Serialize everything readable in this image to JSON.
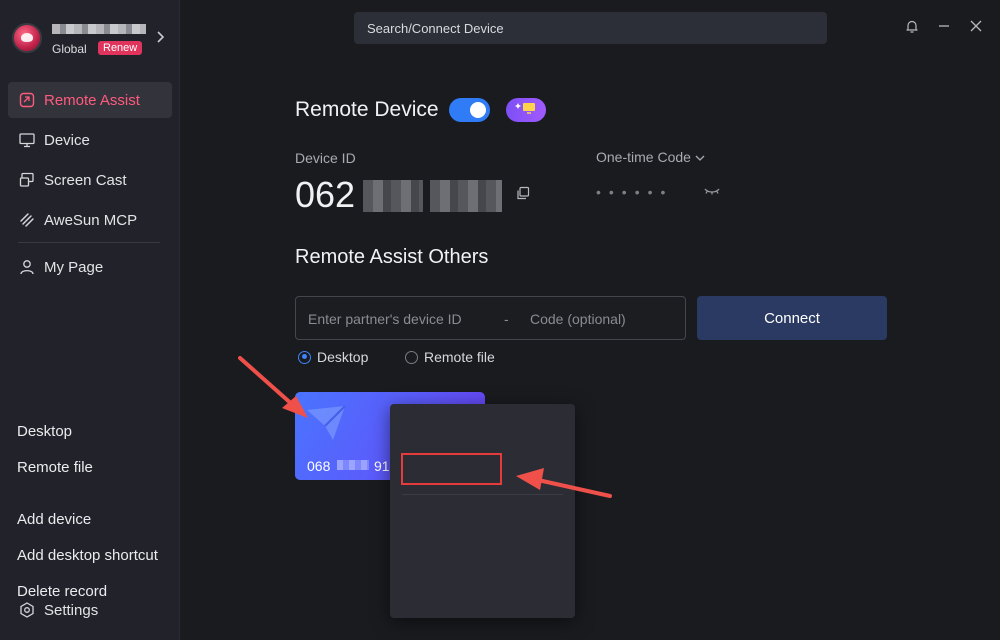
{
  "app": {
    "accent": "#ff5a7e",
    "brand_region": "Global",
    "renew_label": "Renew"
  },
  "sidebar": {
    "items": [
      {
        "label": "Remote Assist",
        "icon": "remote-assist-icon",
        "active": true
      },
      {
        "label": "Device",
        "icon": "monitor-icon",
        "active": false
      },
      {
        "label": "Screen Cast",
        "icon": "screen-cast-icon",
        "active": false
      },
      {
        "label": "AweSun MCP",
        "icon": "mcp-icon",
        "active": false
      },
      {
        "label": "My Page",
        "icon": "user-icon",
        "active": false
      }
    ],
    "settings_label": "Settings"
  },
  "topbar": {
    "search_placeholder": "Search/Connect Device"
  },
  "remote_device": {
    "title": "Remote Device",
    "toggle_on": true,
    "device_id_label": "Device ID",
    "device_id_prefix": "062",
    "one_time_code_label": "One-time Code",
    "one_time_code_masked": "••••••"
  },
  "remote_assist_others": {
    "title": "Remote Assist Others",
    "partner_id_placeholder": "Enter partner's device ID",
    "separator": "-",
    "code_placeholder": "Code (optional)",
    "connect_label": "Connect",
    "modes": [
      {
        "label": "Desktop",
        "checked": true
      },
      {
        "label": "Remote file",
        "checked": false
      }
    ]
  },
  "recent_device": {
    "id_prefix": "068",
    "id_suffix": "91"
  },
  "context_menu": {
    "items": [
      "Desktop",
      "Remote file",
      "Add device",
      "Add desktop shortcut",
      "Delete record"
    ],
    "highlighted": "Remote file"
  }
}
